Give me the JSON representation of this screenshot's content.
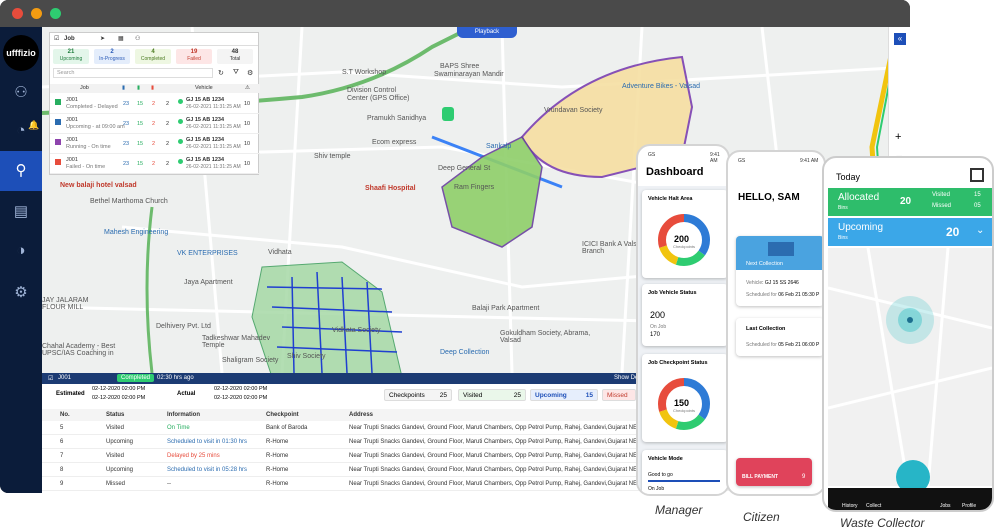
{
  "window": {
    "dots": [
      "#e74c3c",
      "#f39c12",
      "#2ecc71"
    ]
  },
  "brand": {
    "logo": "ufffizio"
  },
  "sidebar": {
    "icons": [
      "user-icon",
      "bell-icon",
      "dashboard-icon",
      "location-pin-icon",
      "document-icon",
      "chart-icon",
      "settings-icon"
    ],
    "glyphs": [
      "⚇",
      "🔔",
      "◔",
      "⚲",
      "▤",
      "◑",
      "⚙"
    ]
  },
  "map": {
    "playback": "Playback",
    "labels": [
      {
        "t": "BAPS Shree",
        "c": ""
      },
      {
        "t": "Swaminarayan Mandir",
        "c": ""
      },
      {
        "t": "S.T Workshop",
        "c": ""
      },
      {
        "t": "Division Control",
        "c": ""
      },
      {
        "t": "Center (GPS Office)",
        "c": ""
      },
      {
        "t": "Adventure Bikes - Valsad",
        "c": ""
      },
      {
        "t": "Vrundavan Society",
        "c": ""
      },
      {
        "t": "Pramukh Sanidhya",
        "c": ""
      },
      {
        "t": "Ecom express",
        "c": ""
      },
      {
        "t": "Shiv temple",
        "c": ""
      },
      {
        "t": "Sankalp",
        "c": ""
      },
      {
        "t": "Deep General St",
        "c": ""
      },
      {
        "t": "Shaafi Hospital",
        "c": "red"
      },
      {
        "t": "Bethel Marthoma Church",
        "c": ""
      },
      {
        "t": "New balaji hotel valsad",
        "c": "red"
      },
      {
        "t": "Mahesh Engineering",
        "c": "blue"
      },
      {
        "t": "VK ENTERPRISES",
        "c": "blue"
      },
      {
        "t": "Jaya Apartment",
        "c": ""
      },
      {
        "t": "JAY JALARAM FLOUR MILL",
        "c": ""
      },
      {
        "t": "Vidhata",
        "c": ""
      },
      {
        "t": "Delhivery Pvt. Ltd",
        "c": ""
      },
      {
        "t": "Tadkeshwar Mahadev Temple",
        "c": ""
      },
      {
        "t": "Shiv Society",
        "c": ""
      },
      {
        "t": "Chahal Academy - Best UPSC/IAS Coaching in",
        "c": ""
      },
      {
        "t": "Balaji Park Apartment",
        "c": ""
      },
      {
        "t": "Gokuldham Society, Abrama, Valsad",
        "c": ""
      },
      {
        "t": "Deep Collection",
        "c": "blue"
      },
      {
        "t": "ICICI Bank A Valsad-Branch",
        "c": ""
      },
      {
        "t": "Ram Fingers",
        "c": ""
      },
      {
        "t": "Vidhata Society",
        "c": ""
      },
      {
        "t": "Shaligram Society",
        "c": ""
      }
    ]
  },
  "job_panel": {
    "tab": "Job",
    "stats": [
      {
        "n": "21",
        "l": "Upcoming"
      },
      {
        "n": "2",
        "l": "In-Progress"
      },
      {
        "n": "4",
        "l": "Completed"
      },
      {
        "n": "19",
        "l": "Failed"
      },
      {
        "n": "48",
        "l": "Total"
      }
    ],
    "search_placeholder": "Search",
    "head_job": "Job",
    "head_vehicle": "Vehicle",
    "rows": [
      {
        "id": "J001",
        "status": "Completed - Delayed",
        "a": "23",
        "b": "15",
        "c": "2",
        "d": "2",
        "vehicle": "GJ 15 AB 1234",
        "time": "26-02-2021 11:31:25 AM",
        "count": "10",
        "color": "#27ae60"
      },
      {
        "id": "J001",
        "status": "Upcoming - at 09:00 am",
        "a": "23",
        "b": "15",
        "c": "2",
        "d": "2",
        "vehicle": "GJ 15 AB 1234",
        "time": "26-02-2021 11:31:25 AM",
        "count": "10",
        "color": "#2b6cb0"
      },
      {
        "id": "J001",
        "status": "Running - On time",
        "a": "23",
        "b": "15",
        "c": "2",
        "d": "2",
        "vehicle": "GJ 15 AB 1234",
        "time": "26-02-2021 11:31:25 AM",
        "count": "10",
        "color": "#8e44ad"
      },
      {
        "id": "J001",
        "status": "Failed - On time",
        "a": "23",
        "b": "15",
        "c": "2",
        "d": "2",
        "vehicle": "GJ 15 AB 1234",
        "time": "26-02-2021 11:31:25 AM",
        "count": "10",
        "color": "#e74c3c"
      }
    ]
  },
  "bottom": {
    "job_id": "J001",
    "completed": "Completed",
    "elapsed": "02:30 hrs ago",
    "show_details": "Show De",
    "estimated": "Estimated",
    "actual": "Actual",
    "est_times": [
      "02-12-2020 02:00 PM",
      "02-12-2020 02:00 PM"
    ],
    "act_times": [
      "02-12-2020 02:00 PM",
      "02-12-2020 02:00 PM"
    ],
    "chips": [
      {
        "l": "Checkpoints",
        "n": "25"
      },
      {
        "l": "Visited",
        "n": "25"
      },
      {
        "l": "Upcoming",
        "n": "15"
      },
      {
        "l": "Missed",
        "n": ""
      }
    ],
    "headers": {
      "no": "No.",
      "status": "Status",
      "info": "Information",
      "checkpoint": "Checkpoint",
      "address": "Address"
    },
    "rows": [
      {
        "no": "5",
        "status": "Visited",
        "info": "On Time",
        "ic": "#27ae60",
        "cp": "Bank of Baroda",
        "addr": "Near Trupti Snacks Gandevi, Ground Floor, Maruti Chambers, Opp Petrol Pump, Rahej, Gandevi,Gujarat NE"
      },
      {
        "no": "6",
        "status": "Upcoming",
        "info": "Scheduled to visit in 01:30 hrs",
        "ic": "#2b6cb0",
        "cp": "R-Home",
        "addr": "Near Trupti Snacks Gandevi, Ground Floor, Maruti Chambers, Opp Petrol Pump, Rahej, Gandevi,Gujarat NE"
      },
      {
        "no": "7",
        "status": "Visited",
        "info": "Delayed by 25 mins",
        "ic": "#e74c3c",
        "cp": "R-Home",
        "addr": "Near Trupti Snacks Gandevi, Ground Floor, Maruti Chambers, Opp Petrol Pump, Rahej, Gandevi,Gujarat NE"
      },
      {
        "no": "8",
        "status": "Upcoming",
        "info": "Scheduled to visit in 05:28 hrs",
        "ic": "#2b6cb0",
        "cp": "R-Home",
        "addr": "Near Trupti Snacks Gandevi, Ground Floor, Maruti Chambers, Opp Petrol Pump, Rahej, Gandevi,Gujarat NE"
      },
      {
        "no": "9",
        "status": "Missed",
        "info": "--",
        "ic": "#333",
        "cp": "R-Home",
        "addr": "Near Trupti Snacks Gandevi, Ground Floor, Maruti Chambers, Opp Petrol Pump, Rahej, Gandevi,Gujarat NE"
      }
    ]
  },
  "manager": {
    "caption": "Manager",
    "title": "Dashboard",
    "time": "9:41 AM",
    "carrier": "GS",
    "halt_title": "Vehicle Halt Area",
    "halt_value": "200",
    "halt_sub": "Checkpoints",
    "status_title": "Job Vehicle Status",
    "status_value": "200",
    "status_label": "On Job",
    "status_value2": "170",
    "checkpoint_title": "Job Checkpoint Status",
    "checkpoint_value": "150",
    "checkpoint_sub": "Checkpoints",
    "mode_title": "Vehicle Mode",
    "mode_item": "Good to go",
    "mode_item2": "On Job",
    "donut": [
      {
        "v": 35,
        "c": "#2e7bd6"
      },
      {
        "v": 20,
        "c": "#2ecc71"
      },
      {
        "v": 15,
        "c": "#f1c40f"
      },
      {
        "v": 30,
        "c": "#e74c3c"
      }
    ]
  },
  "citizen": {
    "caption": "Citizen",
    "greeting": "HELLO, SAM",
    "time": "9:41 AM",
    "carrier": "GS",
    "next_label": "Next Collection",
    "vehicle_label": "Vehicle",
    "vehicle": "GJ 15 SS 2646",
    "sched_label": "Scheduled for",
    "sched": "06 Feb 21 05:30 P",
    "last_label": "Last Collection",
    "last_sched_label": "Scheduled for",
    "last_sched": "05 Feb 21 06:00 P",
    "bill": "BILL PAYMENT",
    "bill_n": "9"
  },
  "collector": {
    "caption": "Waste Collector",
    "today": "Today",
    "time": "9:41 AM",
    "allocated": "Allocated",
    "allocated_n": "20",
    "bins": "Bins",
    "visited": "Visited",
    "visited_n": "15",
    "missed": "Missed",
    "missed_n": "05",
    "upcoming": "Upcoming",
    "upcoming_n": "20",
    "up_bins": "Bins",
    "nav": [
      "History",
      "Collect",
      "Jobs",
      "Profile"
    ]
  }
}
